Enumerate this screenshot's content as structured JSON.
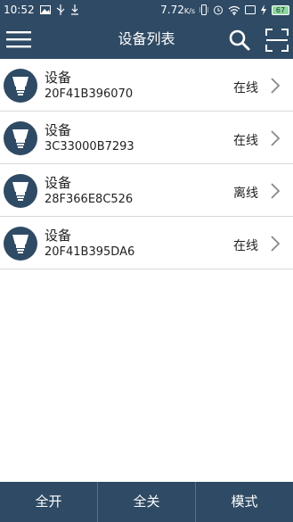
{
  "status_bar": {
    "time": "10:52",
    "battery_percent_label": "7.72",
    "battery_level": "67"
  },
  "header": {
    "title": "设备列表",
    "icons": [
      "menu-icon",
      "search-icon",
      "scan-icon"
    ]
  },
  "devices": [
    {
      "name": "设备",
      "id": "20F41B396070",
      "status": "在线"
    },
    {
      "name": "设备",
      "id": "3C33000B7293",
      "status": "在线"
    },
    {
      "name": "设备",
      "id": "28F366E8C526",
      "status": "离线"
    },
    {
      "name": "设备",
      "id": "20F41B395DA6",
      "status": "在线"
    }
  ],
  "bottom_bar": {
    "all_on": "全开",
    "all_off": "全关",
    "mode": "模式"
  },
  "colors": {
    "primary": "#2f4a64",
    "divider": "#d9d9d9",
    "text": "#222222"
  }
}
